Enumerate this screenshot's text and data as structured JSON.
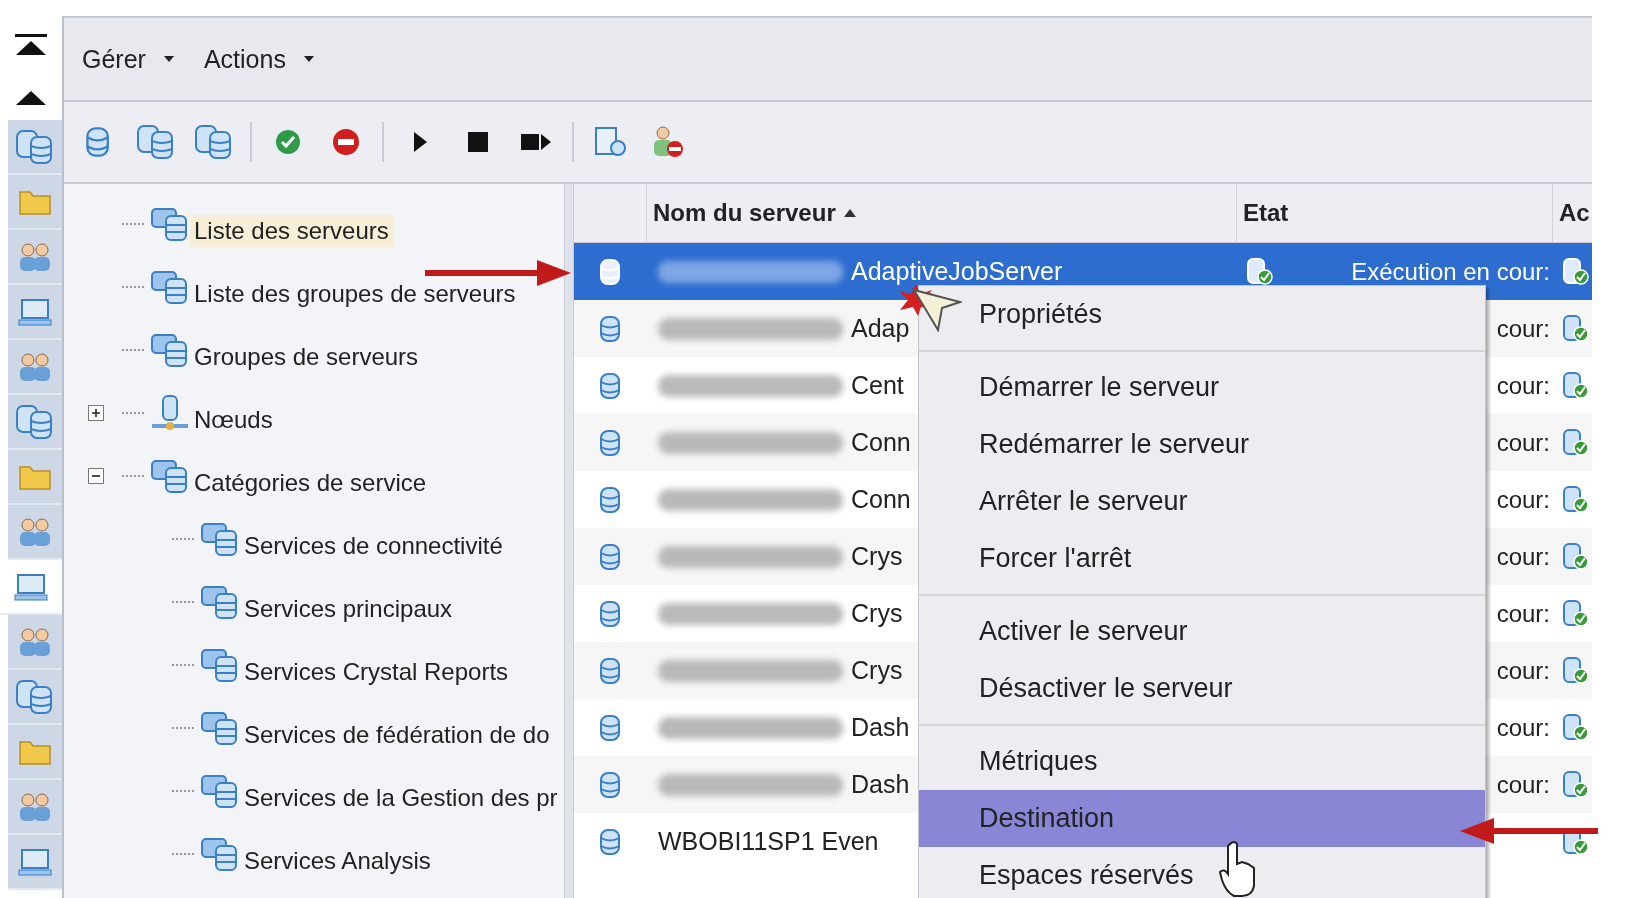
{
  "nav_items": [
    {
      "selected": false
    },
    {
      "selected": false
    },
    {
      "selected": false
    },
    {
      "selected": false
    },
    {
      "selected": false
    },
    {
      "selected": false
    },
    {
      "selected": false
    },
    {
      "selected": false
    },
    {
      "selected": true
    },
    {
      "selected": false
    },
    {
      "selected": false
    },
    {
      "selected": false
    },
    {
      "selected": false
    },
    {
      "selected": false
    }
  ],
  "menu_bar": [
    {
      "label": "Gérer"
    },
    {
      "label": "Actions"
    }
  ],
  "tree": [
    {
      "label": "Liste des serveurs",
      "selected": true
    },
    {
      "label": "Liste des groupes de serveurs",
      "selected": false
    },
    {
      "label": "Groupes de serveurs",
      "selected": false
    },
    {
      "label": "Nœuds",
      "selected": false,
      "expanded": false
    },
    {
      "label": "Catégories de service",
      "selected": false,
      "expanded": true,
      "children": [
        {
          "label": "Services de connectivité",
          "selected": false
        },
        {
          "label": "Services principaux",
          "selected": false
        },
        {
          "label": "Services Crystal Reports",
          "selected": false
        },
        {
          "label": "Services de fédération de do",
          "selected": false
        },
        {
          "label": "Services de la Gestion des pr",
          "selected": false
        },
        {
          "label": "Services Analysis",
          "selected": false
        }
      ]
    }
  ],
  "table": {
    "columns": [
      {
        "label": "Nom du serveur",
        "sorted": true
      },
      {
        "label": "Etat"
      },
      {
        "label": "Ac"
      }
    ],
    "rows": [
      {
        "name": "AdaptiveJobServer",
        "redacted": true,
        "state": "Exécution en cour:",
        "selected": true
      },
      {
        "name": "Adap",
        "redacted": true,
        "state": "cour:",
        "selected": false
      },
      {
        "name": "Cent",
        "redacted": true,
        "state": "cour:",
        "selected": false
      },
      {
        "name": "Conn",
        "redacted": true,
        "state": "cour:",
        "selected": false
      },
      {
        "name": "Conn",
        "redacted": true,
        "state": "cour:",
        "selected": false
      },
      {
        "name": "Crys",
        "redacted": true,
        "state": "cour:",
        "selected": false
      },
      {
        "name": "Crys",
        "redacted": true,
        "state": "cour:",
        "selected": false
      },
      {
        "name": "Crys",
        "redacted": true,
        "state": "cour:",
        "selected": false
      },
      {
        "name": "Dash",
        "redacted": true,
        "state": "cour:",
        "selected": false
      },
      {
        "name": "Dash",
        "redacted": true,
        "state": "cour:",
        "selected": false
      },
      {
        "name": "WBOBI11SP1 Even",
        "redacted": false,
        "selected": false
      }
    ]
  },
  "context_menu": {
    "groups": [
      [
        {
          "label": "Propriétés",
          "selected": false
        }
      ],
      [
        {
          "label": "Démarrer le serveur",
          "selected": false
        },
        {
          "label": "Redémarrer le serveur",
          "selected": false
        },
        {
          "label": "Arrêter le serveur",
          "selected": false
        },
        {
          "label": "Forcer l'arrêt",
          "selected": false
        }
      ],
      [
        {
          "label": "Activer le serveur",
          "selected": false
        },
        {
          "label": "Désactiver le serveur",
          "selected": false
        }
      ],
      [
        {
          "label": "Métriques",
          "selected": false
        },
        {
          "label": "Destination",
          "selected": true
        },
        {
          "label": "Espaces réservés",
          "selected": false
        }
      ]
    ]
  }
}
